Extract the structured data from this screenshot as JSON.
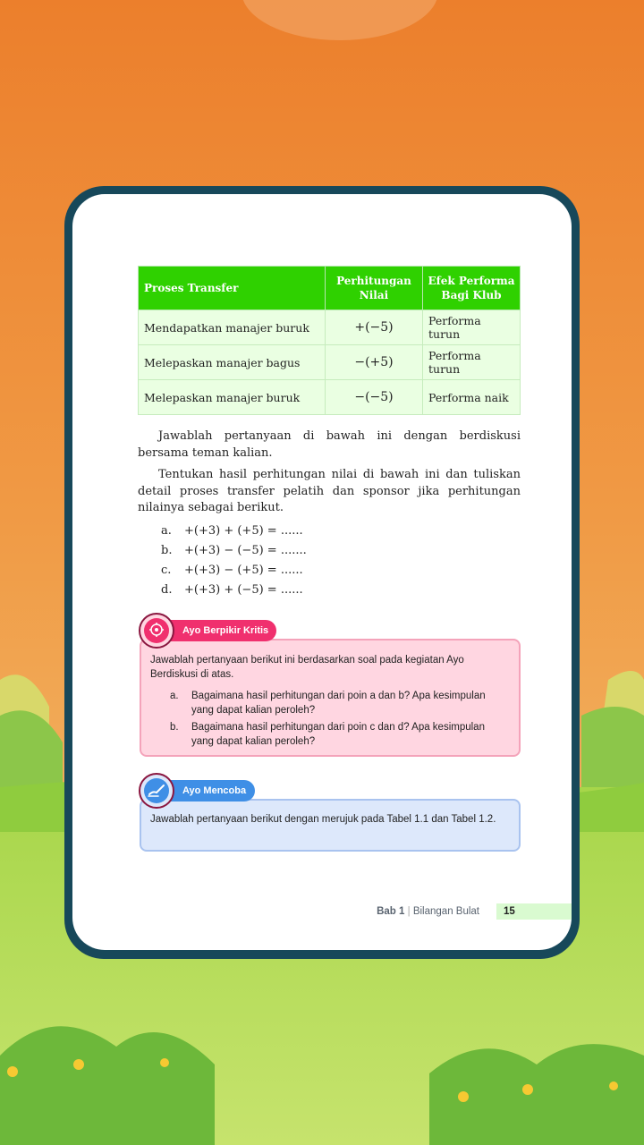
{
  "table": {
    "headers": [
      "Proses Transfer",
      "Perhitungan Nilai",
      "Efek Performa Bagi Klub"
    ],
    "rows": [
      {
        "proses": "Mendapatkan manajer buruk",
        "calc": "+(−5)",
        "efek": "Performa turun"
      },
      {
        "proses": "Melepaskan manajer bagus",
        "calc": "−(+5)",
        "efek": "Performa turun"
      },
      {
        "proses": "Melepaskan manajer buruk",
        "calc": "−(−5)",
        "efek": "Performa naik"
      }
    ]
  },
  "paragraphs": {
    "p1": "Jawablah pertanyaan di bawah ini dengan berdiskusi bersama teman kalian.",
    "p2": "Tentukan hasil perhitungan nilai di bawah ini dan tuliskan detail proses transfer pelatih dan sponsor jika perhitungan nilainya sebagai berikut."
  },
  "questions": [
    {
      "label": "a.",
      "expr": "+(+3) + (+5) = ......"
    },
    {
      "label": "b.",
      "expr": "+(+3) − (−5) = ......."
    },
    {
      "label": "c.",
      "expr": "+(+3) − (+5) = ......"
    },
    {
      "label": "d.",
      "expr": "+(+3) + (−5) = ......"
    }
  ],
  "kritis": {
    "title": "Ayo Berpikir Kritis",
    "intro": "Jawablah pertanyaan berikut ini berdasarkan soal pada kegiatan Ayo Berdiskusi di atas.",
    "items": [
      {
        "label": "a.",
        "text": "Bagaimana hasil perhitungan dari poin a dan b? Apa kesimpulan yang dapat kalian peroleh?"
      },
      {
        "label": "b.",
        "text": "Bagaimana hasil perhitungan dari poin c dan d? Apa kesimpulan yang dapat kalian peroleh?"
      }
    ],
    "icon": "gear-head-icon",
    "color": "#f0306e"
  },
  "mencoba": {
    "title": "Ayo Mencoba",
    "text": "Jawablah pertanyaan berikut dengan merujuk pada Tabel 1.1 dan Tabel 1.2.",
    "icon": "hand-pencil-icon",
    "color": "#3f8fe6"
  },
  "footer": {
    "bab": "Bab 1",
    "separator": "|",
    "chapter": "Bilangan Bulat",
    "page": "15"
  }
}
